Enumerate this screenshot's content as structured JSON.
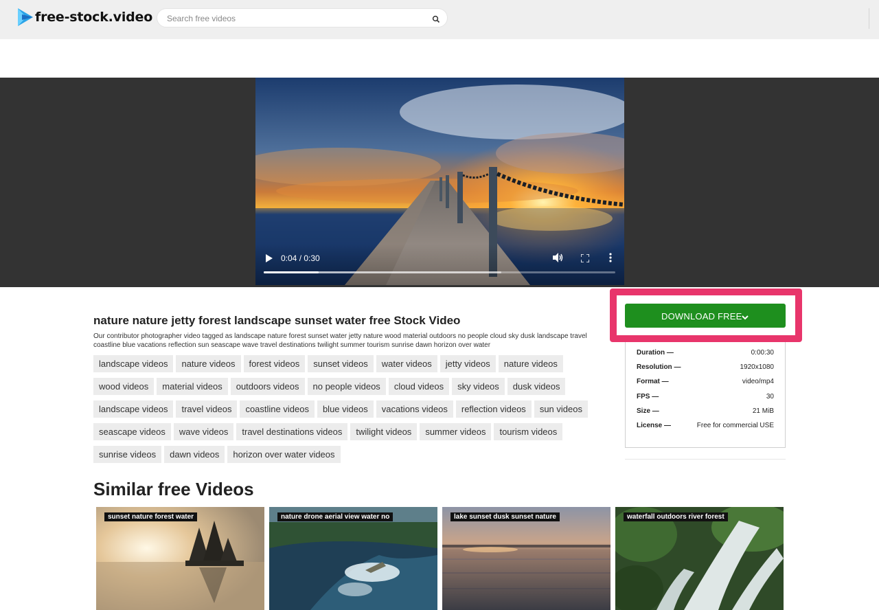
{
  "header": {
    "logo_text": "free-stock.video",
    "search_placeholder": "Search free videos"
  },
  "player": {
    "time": "0:04 / 0:30",
    "progress_played_fraction": 0.156,
    "progress_buffered_fraction": 0.675
  },
  "video": {
    "title": "nature nature jetty forest landscape sunset water free Stock Video",
    "description": "Our contributor photographer video tagged as landscape nature forest sunset water jetty nature wood material outdoors no people cloud sky dusk landscape travel coastline blue vacations reflection sun seascape wave travel destinations twilight summer tourism sunrise dawn horizon over water"
  },
  "tags": [
    "landscape videos",
    "nature videos",
    "forest videos",
    "sunset videos",
    "water videos",
    "jetty videos",
    "nature videos",
    "wood videos",
    "material videos",
    "outdoors videos",
    "no people videos",
    "cloud videos",
    "sky videos",
    "dusk videos",
    "landscape videos",
    "travel videos",
    "coastline videos",
    "blue videos",
    "vacations videos",
    "reflection videos",
    "sun videos",
    "seascape videos",
    "wave videos",
    "travel destinations videos",
    "twilight videos",
    "summer videos",
    "tourism videos",
    "sunrise videos",
    "dawn videos",
    "horizon over water videos"
  ],
  "download": {
    "label": "DOWNLOAD FREE",
    "color": "#1e8f1e",
    "highlight_color": "#e8356b"
  },
  "info": {
    "duration_label": "Duration —",
    "duration": "0:00:30",
    "resolution_label": "Resolution —",
    "resolution": "1920x1080",
    "format_label": "Format —",
    "format": "video/mp4",
    "fps_label": "FPS —",
    "fps": "30",
    "size_label": "Size —",
    "size": "21 MiB",
    "license_label": "License —",
    "license": "Free for commercial USE"
  },
  "similar": {
    "heading": "Similar free Videos",
    "items": [
      {
        "label": "sunset nature forest water"
      },
      {
        "label": "nature drone aerial view water no"
      },
      {
        "label": "lake sunset dusk sunset nature"
      },
      {
        "label": "waterfall outdoors river forest"
      }
    ]
  }
}
